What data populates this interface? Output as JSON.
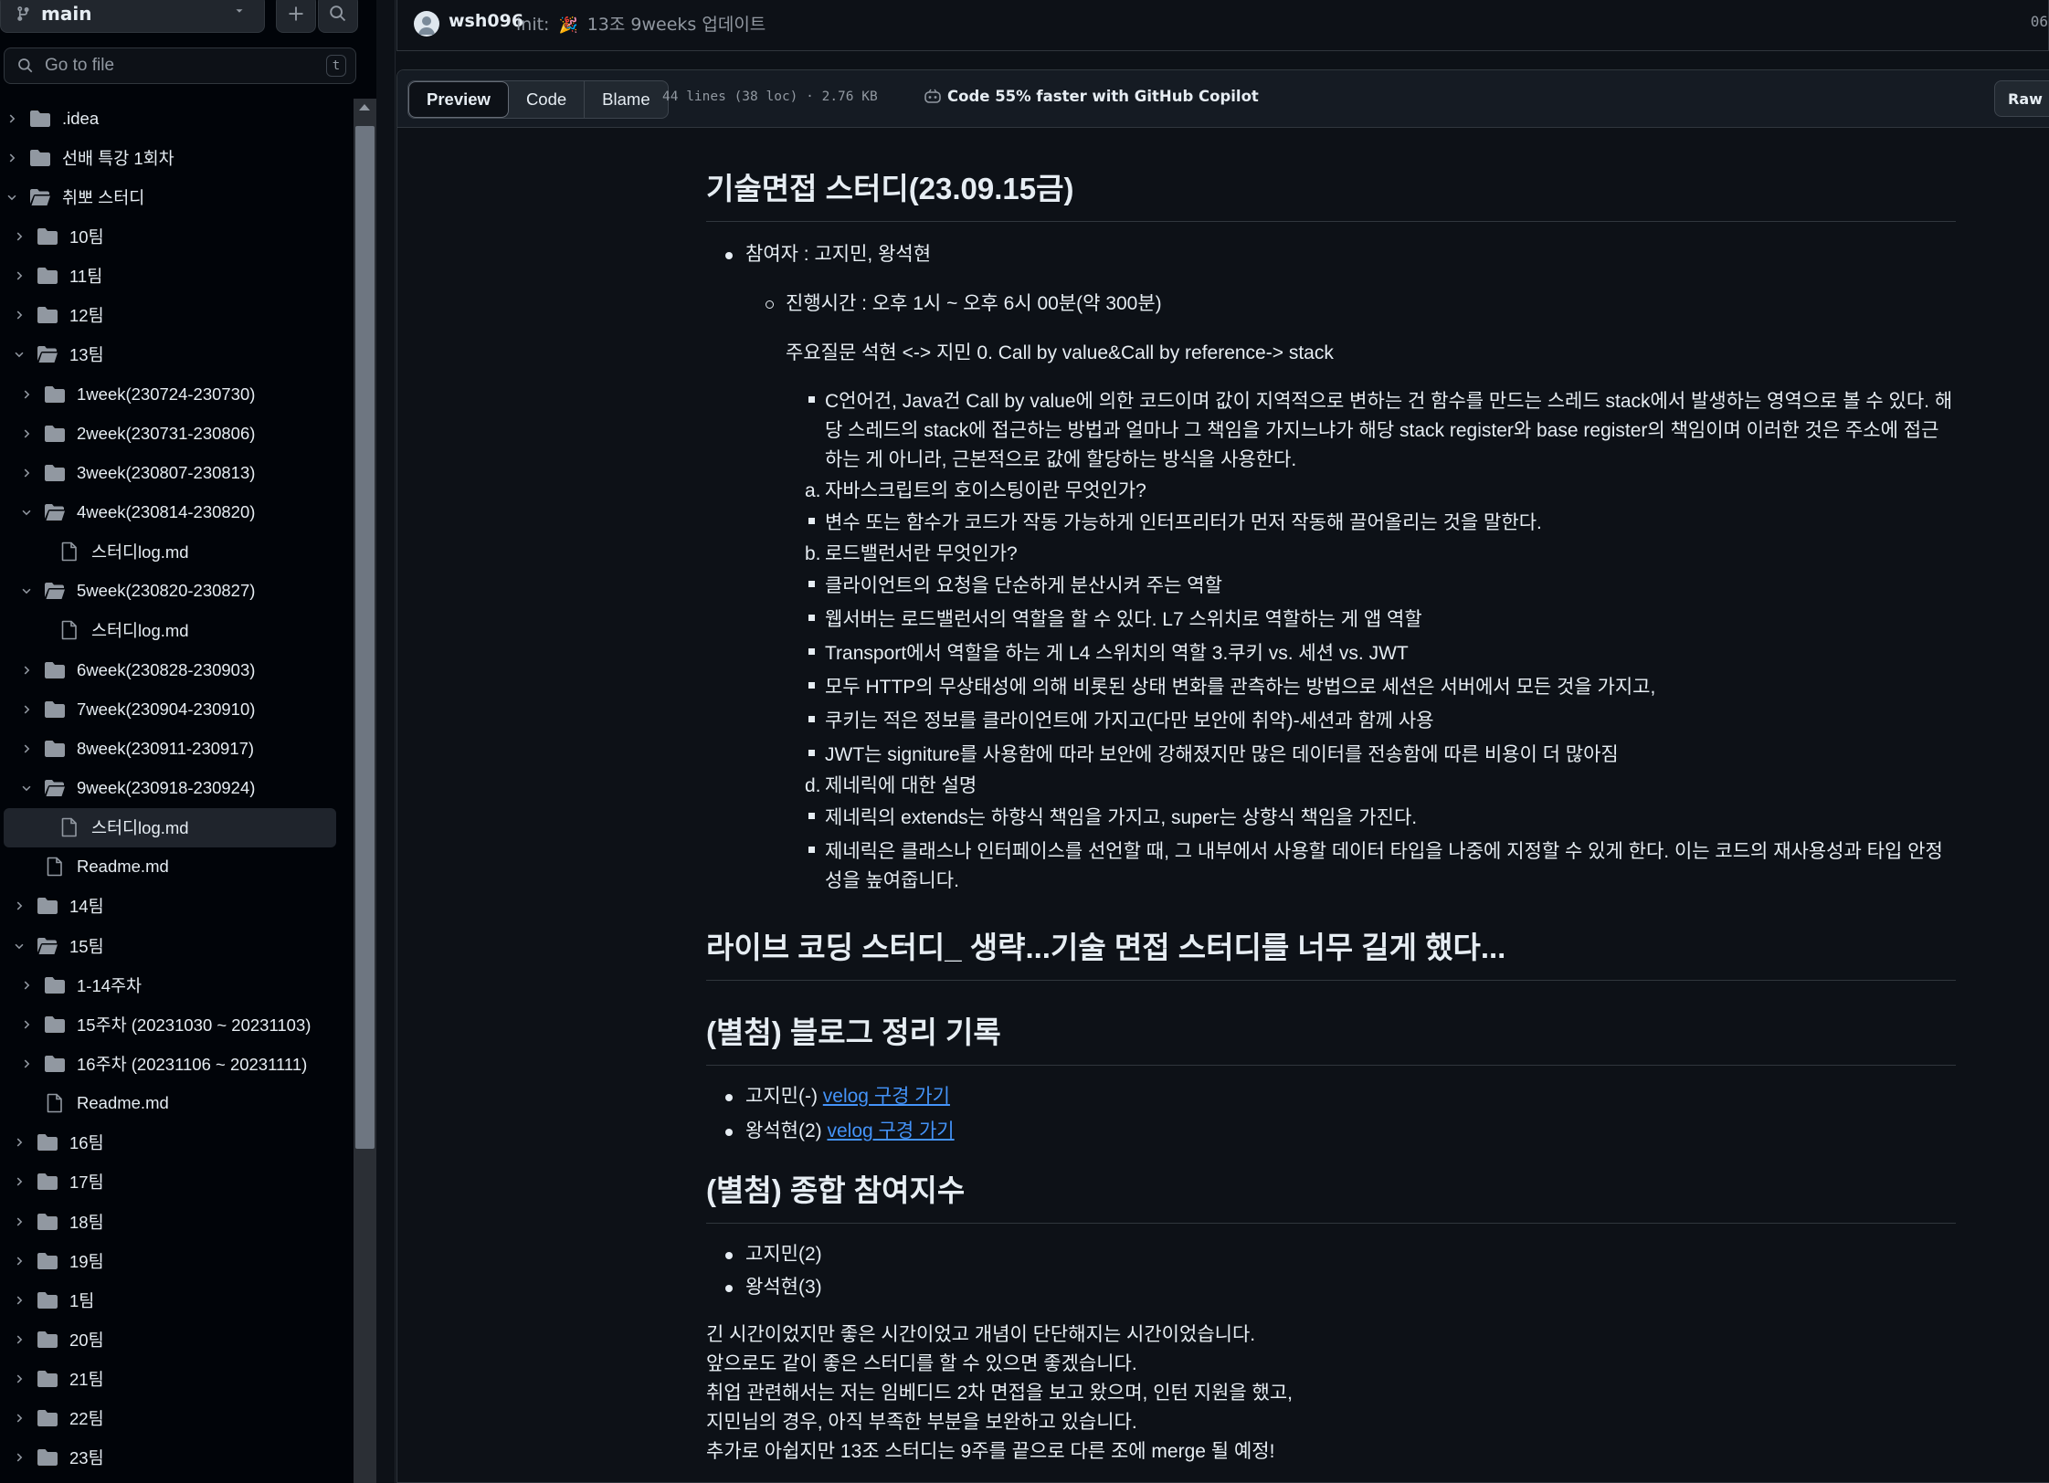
{
  "sidebar": {
    "branch": "main",
    "goto_placeholder": "Go to file",
    "goto_shortcut": "t",
    "tree": [
      {
        "name": ".idea",
        "type": "folder",
        "depth": 0,
        "expanded": false
      },
      {
        "name": "선배 특강 1회차",
        "type": "folder",
        "depth": 0,
        "expanded": false
      },
      {
        "name": "취뽀 스터디",
        "type": "folder",
        "depth": 0,
        "expanded": true
      },
      {
        "name": "10팀",
        "type": "folder",
        "depth": 1,
        "expanded": false
      },
      {
        "name": "11팀",
        "type": "folder",
        "depth": 1,
        "expanded": false
      },
      {
        "name": "12팀",
        "type": "folder",
        "depth": 1,
        "expanded": false
      },
      {
        "name": "13팀",
        "type": "folder",
        "depth": 1,
        "expanded": true
      },
      {
        "name": "1week(230724-230730)",
        "type": "folder",
        "depth": 2,
        "expanded": false
      },
      {
        "name": "2week(230731-230806)",
        "type": "folder",
        "depth": 2,
        "expanded": false
      },
      {
        "name": "3week(230807-230813)",
        "type": "folder",
        "depth": 2,
        "expanded": false
      },
      {
        "name": "4week(230814-230820)",
        "type": "folder",
        "depth": 2,
        "expanded": true
      },
      {
        "name": "스터디log.md",
        "type": "file",
        "depth": 3
      },
      {
        "name": "5week(230820-230827)",
        "type": "folder",
        "depth": 2,
        "expanded": true
      },
      {
        "name": "스터디log.md",
        "type": "file",
        "depth": 3
      },
      {
        "name": "6week(230828-230903)",
        "type": "folder",
        "depth": 2,
        "expanded": false
      },
      {
        "name": "7week(230904-230910)",
        "type": "folder",
        "depth": 2,
        "expanded": false
      },
      {
        "name": "8week(230911-230917)",
        "type": "folder",
        "depth": 2,
        "expanded": false
      },
      {
        "name": "9week(230918-230924)",
        "type": "folder",
        "depth": 2,
        "expanded": true
      },
      {
        "name": "스터디log.md",
        "type": "file",
        "depth": 3,
        "selected": true
      },
      {
        "name": "Readme.md",
        "type": "file",
        "depth": 2
      },
      {
        "name": "14팀",
        "type": "folder",
        "depth": 1,
        "expanded": false
      },
      {
        "name": "15팀",
        "type": "folder",
        "depth": 1,
        "expanded": true
      },
      {
        "name": "1-14주차",
        "type": "folder",
        "depth": 2,
        "expanded": false
      },
      {
        "name": "15주차 (20231030 ~ 20231103)",
        "type": "folder",
        "depth": 2,
        "expanded": false
      },
      {
        "name": "16주차 (20231106 ~ 20231111)",
        "type": "folder",
        "depth": 2,
        "expanded": false
      },
      {
        "name": "Readme.md",
        "type": "file",
        "depth": 2
      },
      {
        "name": "16팀",
        "type": "folder",
        "depth": 1,
        "expanded": false
      },
      {
        "name": "17팀",
        "type": "folder",
        "depth": 1,
        "expanded": false
      },
      {
        "name": "18팀",
        "type": "folder",
        "depth": 1,
        "expanded": false
      },
      {
        "name": "19팀",
        "type": "folder",
        "depth": 1,
        "expanded": false
      },
      {
        "name": "1팀",
        "type": "folder",
        "depth": 1,
        "expanded": false
      },
      {
        "name": "20팀",
        "type": "folder",
        "depth": 1,
        "expanded": false
      },
      {
        "name": "21팀",
        "type": "folder",
        "depth": 1,
        "expanded": false
      },
      {
        "name": "22팀",
        "type": "folder",
        "depth": 1,
        "expanded": false
      },
      {
        "name": "23팀",
        "type": "folder",
        "depth": 1,
        "expanded": false
      }
    ]
  },
  "commit": {
    "user": "wsh096",
    "message_prefix": "init:",
    "message_emoji": "🎉",
    "message": "13조 9weeks 업데이트",
    "sha_partial": "06"
  },
  "file_header": {
    "tabs": [
      "Preview",
      "Code",
      "Blame"
    ],
    "active_tab": "Preview",
    "info": "44 lines (38 loc) · 2.76 KB",
    "copilot": "Code 55% faster with GitHub Copilot",
    "raw": "Raw"
  },
  "doc": {
    "h1": "기술면접 스터디(23.09.15금)",
    "participants": "참여자 : 고지민, 왕석현",
    "time": "진행시간 : 오후 1시 ~ 오후 6시 00분(약 300분)",
    "main_q": "주요질문 석현 <-> 지민 0. Call by value&Call by reference-> stack",
    "items": [
      {
        "marker": "sq",
        "text": "C언어건, Java건 Call by value에 의한 코드이며 값이 지역적으로 변하는 건 함수를 만드는 스레드 stack에서 발생하는 영역으로 볼 수 있다. 해당 스레드의 stack에 접근하는 방법과 얼마나 그 책임을 가지느냐가 해당 stack register와 base register의 책임이며 이러한 것은 주소에 접근하는 게 아니라, 근본적으로 값에 할당하는 방식을 사용한다."
      },
      {
        "marker": "a.",
        "text": "자바스크립트의 호이스팅이란 무엇인가?"
      },
      {
        "marker": "sq",
        "text": "변수 또는 함수가 코드가 작동 가능하게 인터프리터가 먼저 작동해 끌어올리는 것을 말한다."
      },
      {
        "marker": "b.",
        "text": "로드밸런서란 무엇인가?"
      },
      {
        "marker": "sq",
        "text": "클라이언트의 요청을 단순하게 분산시켜 주는 역할"
      },
      {
        "marker": "sq",
        "text": "웹서버는 로드밸런서의 역할을 할 수 있다. L7 스위치로 역할하는 게 앱 역할"
      },
      {
        "marker": "sq",
        "text": "Transport에서 역할을 하는 게 L4 스위치의 역할 3.쿠키 vs. 세션 vs. JWT"
      },
      {
        "marker": "sq",
        "text": "모두 HTTP의 무상태성에 의해 비롯된 상태 변화를 관측하는 방법으로 세션은 서버에서 모든 것을 가지고,"
      },
      {
        "marker": "sq",
        "text": "쿠키는 적은 정보를 클라이언트에 가지고(다만 보안에 취약)-세션과 함께 사용"
      },
      {
        "marker": "sq",
        "text": "JWT는 signiture를 사용함에 따라 보안에 강해졌지만 많은 데이터를 전송함에 따른 비용이 더 많아짐"
      },
      {
        "marker": "d.",
        "text": "제네릭에 대한 설명"
      },
      {
        "marker": "sq",
        "text": "제네릭의 extends는 하향식 책임을 가지고, super는 상향식 책임을 가진다."
      },
      {
        "marker": "sq",
        "text": "제네릭은 클래스나 인터페이스를 선언할 때, 그 내부에서 사용할 데이터 타입을 나중에 지정할 수 있게 한다. 이는 코드의 재사용성과 타입 안정성을 높여줍니다."
      }
    ],
    "h2_live": "라이브 코딩 스터디_ 생략...기술 면접 스터디를 너무 길게 했다...",
    "h2_blog": "(별첨) 블로그 정리 기록",
    "blog": [
      {
        "prefix": "고지민(-) ",
        "link": "velog 구경 가기"
      },
      {
        "prefix": "왕석현(2) ",
        "link": "velog 구경 가기"
      }
    ],
    "h2_count": "(별첨) 종합 참여지수",
    "counts": [
      "고지민(2)",
      "왕석현(3)"
    ],
    "closing": [
      "긴 시간이었지만 좋은 시간이었고 개념이 단단해지는 시간이었습니다.",
      "앞으로도 같이 좋은 스터디를 할 수 있으면 좋겠습니다.",
      "취업 관련해서는 저는 임베디드 2차 면접을 보고 왔으며, 인턴 지원을 했고,",
      "지민님의 경우, 아직 부족한 부분을 보완하고 있습니다.",
      "추가로 아쉽지만 13조 스터디는 9주를 끝으로 다른 조에 merge 될 예정!"
    ]
  }
}
